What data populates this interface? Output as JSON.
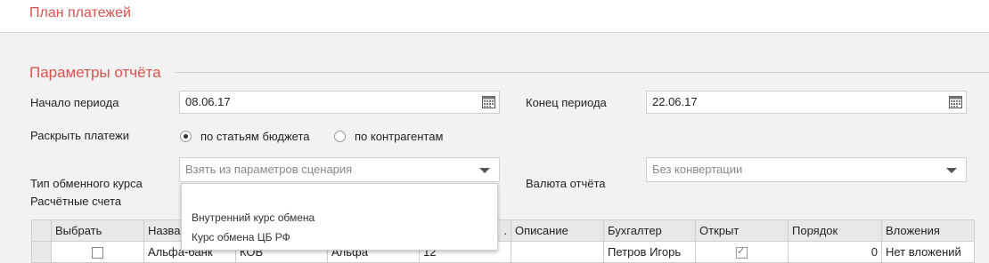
{
  "app": {
    "title": "План платежей"
  },
  "section": {
    "title": "Параметры отчёта"
  },
  "period": {
    "start_label": "Начало периода",
    "start_value": "08.06.17",
    "end_label": "Конец периода",
    "end_value": "22.06.17"
  },
  "expand": {
    "label": "Раскрыть платежи",
    "options": [
      {
        "label": "по статьям бюджета",
        "selected": true
      },
      {
        "label": "по контрагентам",
        "selected": false
      }
    ]
  },
  "rate": {
    "label": "Тип обменного курса",
    "selected": "Взять из параметров сценария",
    "options": [
      "Внутренний курс обмена",
      "Курс обмена ЦБ РФ"
    ]
  },
  "currency": {
    "label": "Валюта отчёта",
    "selected": "Без конвертации"
  },
  "accounts": {
    "label": "Расчётные счета"
  },
  "table": {
    "headers": [
      "Выбрать",
      "Назва",
      "",
      "",
      ".",
      "Описание",
      "Бухгалтер",
      "Открыт",
      "Порядок",
      "Вложения"
    ],
    "rows": [
      {
        "select": false,
        "name": "Альфа-банк",
        "c2": "КОВ",
        "c3": "Альфа",
        "c4": "12",
        "desc": "",
        "accountant": "Петров Игорь",
        "open": true,
        "order": "0",
        "attachments": "Нет вложений"
      }
    ]
  }
}
